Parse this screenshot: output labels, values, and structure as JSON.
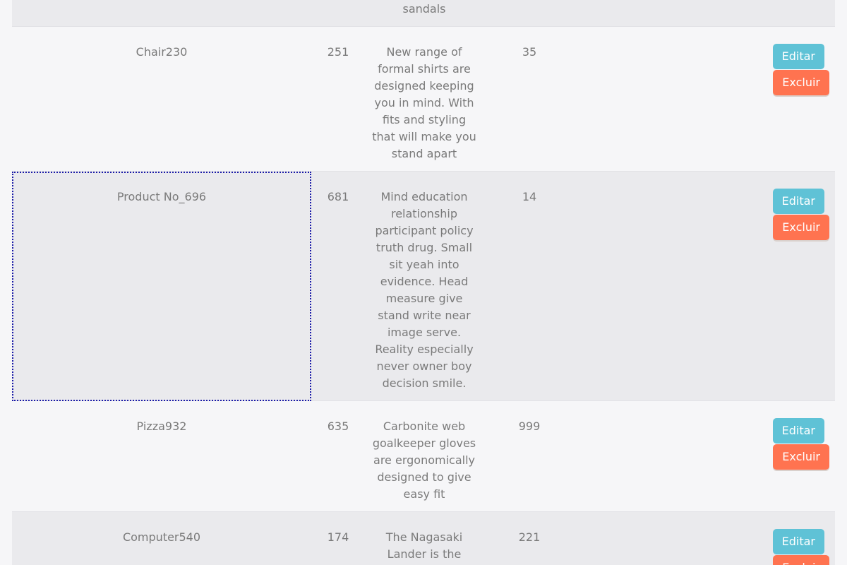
{
  "buttons": {
    "edit_label": "Editar",
    "delete_label": "Excluir"
  },
  "colors": {
    "edit_button": "#5fc2d6",
    "delete_button": "#ff7350",
    "row_odd": "#eaeaed",
    "row_even": "#f6f6f8",
    "selection_outline": "#1a1aa8"
  },
  "rows": [
    {
      "name": "",
      "id": "",
      "description": "range of shoes & sandals",
      "quantity": ""
    },
    {
      "name": "Chair230",
      "id": "251",
      "description": "New range of formal shirts are designed keeping you in mind. With fits and styling that will make you stand apart",
      "quantity": "35"
    },
    {
      "name": "Product No_696",
      "id": "681",
      "description": "Mind education relationship participant policy truth drug. Small sit yeah into evidence. Head measure give stand write near image serve. Reality especially never owner boy decision smile.",
      "quantity": "14"
    },
    {
      "name": "Pizza932",
      "id": "635",
      "description": "Carbonite web goalkeeper gloves are ergonomically designed to give easy fit",
      "quantity": "999"
    },
    {
      "name": "Computer540",
      "id": "174",
      "description": "The Nagasaki Lander is the trademarked",
      "quantity": "221"
    }
  ]
}
